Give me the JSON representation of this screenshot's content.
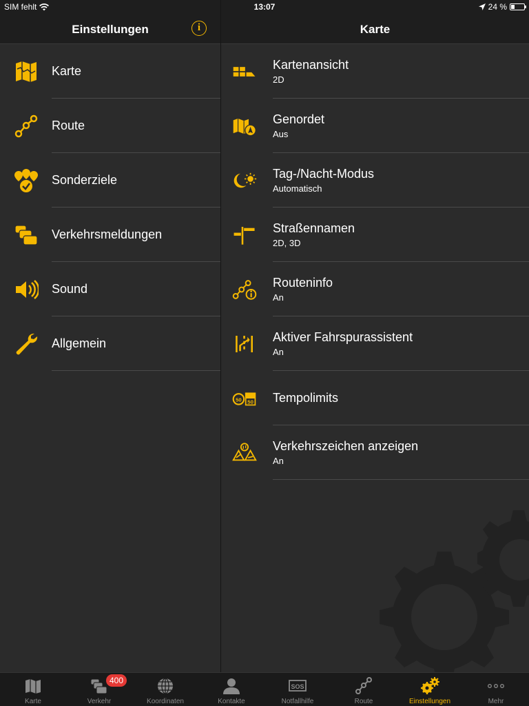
{
  "statusbar": {
    "carrier": "SIM fehlt",
    "time": "13:07",
    "battery": "24 %"
  },
  "left_header": {
    "title": "Einstellungen"
  },
  "right_header": {
    "title": "Karte"
  },
  "settings_menu": [
    {
      "label": "Karte",
      "icon": "map-icon"
    },
    {
      "label": "Route",
      "icon": "route-icon"
    },
    {
      "label": "Sonderziele",
      "icon": "poi-icon"
    },
    {
      "label": "Verkehrsmeldungen",
      "icon": "traffic-icon"
    },
    {
      "label": "Sound",
      "icon": "speaker-icon"
    },
    {
      "label": "Allgemein",
      "icon": "wrench-icon"
    }
  ],
  "map_settings": [
    {
      "title": "Kartenansicht",
      "value": "2D",
      "icon": "map-view-icon"
    },
    {
      "title": "Genordet",
      "value": "Aus",
      "icon": "north-up-icon"
    },
    {
      "title": "Tag-/Nacht-Modus",
      "value": "Automatisch",
      "icon": "day-night-icon"
    },
    {
      "title": "Straßennamen",
      "value": "2D, 3D",
      "icon": "street-sign-icon"
    },
    {
      "title": "Routeninfo",
      "value": "An",
      "icon": "route-info-icon"
    },
    {
      "title": "Aktiver Fahrspurassistent",
      "value": "An",
      "icon": "lane-assist-icon"
    },
    {
      "title": "Tempolimits",
      "value": "",
      "icon": "speed-limit-icon"
    },
    {
      "title": "Verkehrszeichen anzeigen",
      "value": "An",
      "icon": "traffic-sign-icon"
    }
  ],
  "tabbar": [
    {
      "label": "Karte",
      "icon": "map-icon"
    },
    {
      "label": "Verkehr",
      "icon": "traffic-icon",
      "badge": "400"
    },
    {
      "label": "Koordinaten",
      "icon": "globe-icon"
    },
    {
      "label": "Kontakte",
      "icon": "contact-icon"
    },
    {
      "label": "Notfallhilfe",
      "icon": "sos-icon"
    },
    {
      "label": "Route",
      "icon": "route-icon"
    },
    {
      "label": "Einstellungen",
      "icon": "gears-icon",
      "active": true
    },
    {
      "label": "Mehr",
      "icon": "more-icon"
    }
  ],
  "colors": {
    "accent": "#f5b800",
    "background": "#2b2b2b",
    "bar": "#1e1e1e"
  }
}
